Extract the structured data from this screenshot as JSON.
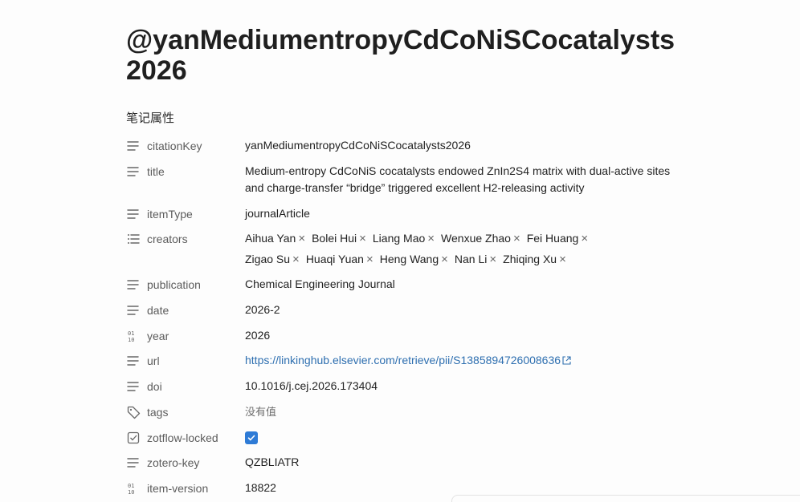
{
  "note": {
    "title": "@yanMediumentropyCdCoNiSCocatalysts2026"
  },
  "properties": {
    "heading": "笔记属性",
    "citationKey": {
      "key": "citationKey",
      "icon": "text-lines-icon",
      "value": "yanMediumentropyCdCoNiSCocatalysts2026"
    },
    "title": {
      "key": "title",
      "icon": "text-lines-icon",
      "value": "Medium-entropy CdCoNiS cocatalysts endowed ZnIn2S4 matrix with dual-active sites and charge-transfer “bridge” triggered excellent H2-releasing activity"
    },
    "itemType": {
      "key": "itemType",
      "icon": "text-lines-icon",
      "value": "journalArticle"
    },
    "creators": {
      "key": "creators",
      "icon": "list-icon",
      "values": [
        "Aihua Yan",
        "Bolei Hui",
        "Liang Mao",
        "Wenxue Zhao",
        "Fei Huang",
        "Zigao Su",
        "Huaqi Yuan",
        "Heng Wang",
        "Nan Li",
        "Zhiqing Xu"
      ]
    },
    "publication": {
      "key": "publication",
      "icon": "text-lines-icon",
      "value": "Chemical Engineering Journal"
    },
    "date": {
      "key": "date",
      "icon": "text-lines-icon",
      "value": "2026-2"
    },
    "year": {
      "key": "year",
      "icon": "binary-number-icon",
      "value": "2026"
    },
    "url": {
      "key": "url",
      "icon": "text-lines-icon",
      "value": "https://linkinghub.elsevier.com/retrieve/pii/S1385894726008636"
    },
    "doi": {
      "key": "doi",
      "icon": "text-lines-icon",
      "value": "10.1016/j.cej.2026.173404"
    },
    "tags": {
      "key": "tags",
      "icon": "tag-icon",
      "value": "没有值"
    },
    "zotflowLocked": {
      "key": "zotflow-locked",
      "icon": "checkbox-icon",
      "checked": true
    },
    "zoteroKey": {
      "key": "zotero-key",
      "icon": "text-lines-icon",
      "value": "QZBLIATR"
    },
    "itemVersion": {
      "key": "item-version",
      "icon": "binary-number-icon",
      "value": "18822"
    }
  },
  "colors": {
    "link": "#2e6fb0",
    "checkbox": "#2e7bd6",
    "text": "#222222",
    "muted": "#5c5c5c"
  }
}
